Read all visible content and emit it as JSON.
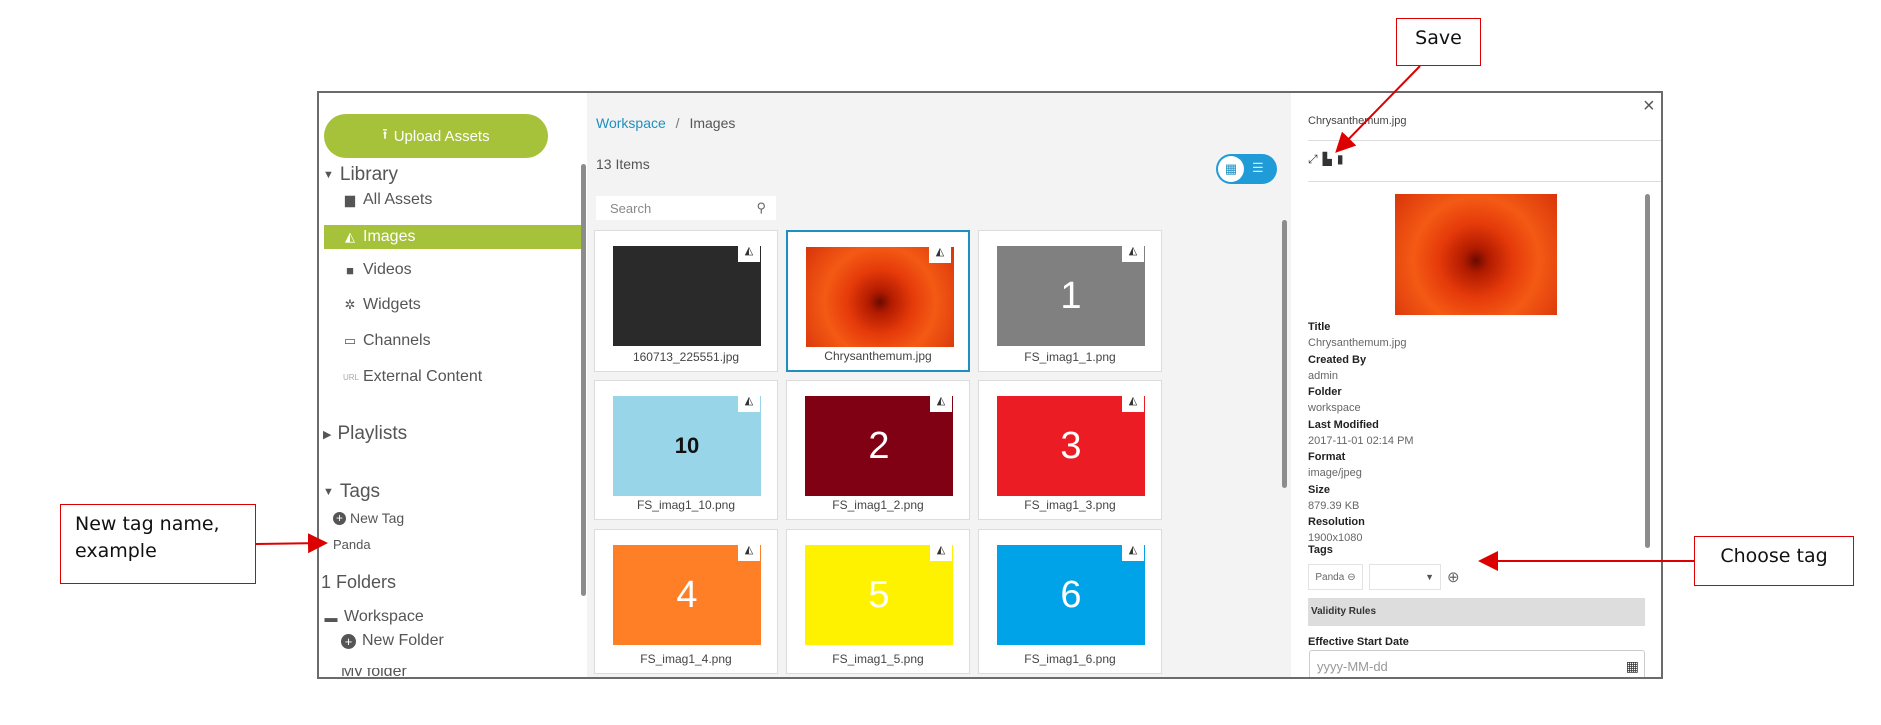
{
  "sidebar": {
    "upload_label": "Upload Assets",
    "library": "Library",
    "items": [
      {
        "label": "All Assets",
        "icon": "file-icon"
      },
      {
        "label": "Images",
        "icon": "image-icon"
      },
      {
        "label": "Videos",
        "icon": "video-icon"
      },
      {
        "label": "Widgets",
        "icon": "gear-icon"
      },
      {
        "label": "Channels",
        "icon": "monitor-icon"
      },
      {
        "label": "External Content",
        "icon": "url-icon"
      }
    ],
    "playlists": "Playlists",
    "tags": "Tags",
    "new_tag": "New Tag",
    "tag_items": [
      "Panda"
    ],
    "folders_count": "1 Folders",
    "workspace": "Workspace",
    "new_folder": "New Folder",
    "cut_folder": "My folder"
  },
  "main": {
    "breadcrumb": {
      "root": "Workspace",
      "sep": "/",
      "current": "Images"
    },
    "count": "13 Items",
    "search_placeholder": "Search",
    "cards": [
      {
        "name": "160713_225551.jpg",
        "label": "",
        "color": "#2a2a2a"
      },
      {
        "name": "Chrysanthemum.jpg",
        "label": "",
        "color": "#e0400e"
      },
      {
        "name": "FS_imag1_1.png",
        "label": "1",
        "color": "#808080"
      },
      {
        "name": "FS_imag1_10.png",
        "label": "10",
        "color": "#99d5e8"
      },
      {
        "name": "FS_imag1_2.png",
        "label": "2",
        "color": "#800014"
      },
      {
        "name": "FS_imag1_3.png",
        "label": "3",
        "color": "#ec1c24"
      },
      {
        "name": "FS_imag1_4.png",
        "label": "4",
        "color": "#ff7f27"
      },
      {
        "name": "FS_imag1_5.png",
        "label": "5",
        "color": "#fff200"
      },
      {
        "name": "FS_imag1_6.png",
        "label": "6",
        "color": "#00a2e8"
      }
    ]
  },
  "detail": {
    "title": "Chrysanthemum.jpg",
    "fields": [
      {
        "label": "Title",
        "value": "Chrysanthemum.jpg"
      },
      {
        "label": "Created By",
        "value": "admin"
      },
      {
        "label": "Folder",
        "value": "workspace"
      },
      {
        "label": "Last Modified",
        "value": "2017-11-01 02:14 PM"
      },
      {
        "label": "Format",
        "value": "image/jpeg"
      },
      {
        "label": "Size",
        "value": "879.39 KB"
      },
      {
        "label": "Resolution",
        "value": "1900x1080"
      }
    ],
    "tags_label": "Tags",
    "tag_chip": "Panda",
    "validity": "Validity Rules",
    "start_date_label": "Effective Start Date",
    "date_placeholder": "yyyy-MM-dd"
  },
  "annotations": {
    "save": "Save",
    "new_tag": "New tag name, example",
    "choose_tag": "Choose tag"
  },
  "colors": {
    "accent": "#a5c23a",
    "link": "#1f8fbf",
    "annotation": "#dd0000"
  }
}
